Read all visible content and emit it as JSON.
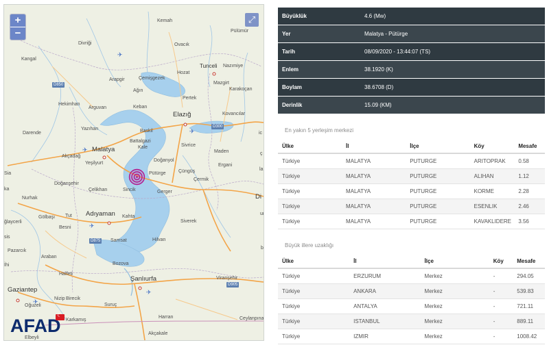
{
  "map": {
    "controls": {
      "zoom_in": "+",
      "zoom_out": "−",
      "fullscreen": "⤢"
    },
    "logo": "AFAD",
    "labels": {
      "kemah": "Kemah",
      "pulumur": "Pülümür",
      "divrigi": "Divriği",
      "ovacik": "Ovacık",
      "kangal": "Kangal",
      "tunceli": "Tunceli",
      "nazimiye": "Nazımiye",
      "arapgir": "Arapgir",
      "cemisgezek": "Çemişgezek",
      "hozat": "Hozat",
      "mazgirt": "Mazgirt",
      "karakocan": "Karakoçan",
      "agin": "Ağın",
      "pertek": "Pertek",
      "hekimhan": "Hekimhan",
      "arguvan": "Arguvan",
      "keban": "Keban",
      "elazig": "Elazığ",
      "kovancilar": "Kovancılar",
      "yazihan": "Yazıhan",
      "baskil": "Baskil",
      "darende": "Darende",
      "battalgazi": "Battalgazi",
      "sivrice": "Sivrice",
      "kale": "Kale",
      "malatya": "Malatya",
      "akcadag": "Akçadağ",
      "yesilyurt": "Yeşilyurt",
      "doganyol": "Doğanyol",
      "maden": "Maden",
      "puturge": "Pütürge",
      "cungus": "Çüngüş",
      "ergani": "Ergani",
      "doganshehir": "Doğanşehir",
      "celikhan": "Çelikhan",
      "sincik": "Sincik",
      "cermik": "Çermik",
      "gerger": "Gerger",
      "nurhak": "Nurhak",
      "golbasi": "Gölbaşı",
      "tut": "Tut",
      "adiyaman": "Adıyaman",
      "kahta": "Kahta",
      "siverek": "Siverek",
      "besni": "Besni",
      "samsat": "Samsat",
      "hilvan": "Hilvan",
      "pazarcik": "Pazarcık",
      "araban": "Araban",
      "bozova": "Bozova",
      "haifeti": "Halfeti",
      "sanliurfa": "Şanlıurfa",
      "viransehir": "Viranşehir",
      "gaziantep": "Gaziantep",
      "oguzeli": "Oğuzeli",
      "nizip": "Nizip",
      "birecik": "Birecik",
      "suruc": "Suruç",
      "harran": "Harran",
      "karkamis": "Karkamış",
      "akcakale": "Akçakale",
      "ceylanpinar": "Ceylanpınar",
      "elbeyli": "Elbeyli",
      "cag": "ğlaycerli",
      "sis": "sis",
      "di": "Di",
      "ic": "ic",
      "ur": "ur",
      "cb": "ç",
      "bi": "bi",
      "la": "la",
      "ka": "ka",
      "ihi": "İhi",
      "sia": "Sia"
    },
    "roads": {
      "d850": "D850",
      "d300": "D300",
      "d875": "D875",
      "d905": "D905"
    }
  },
  "info": [
    {
      "key": "Büyüklük",
      "value": "4.6 (Mw)"
    },
    {
      "key": "Yer",
      "value": "Malatya - Pütürge"
    },
    {
      "key": "Tarih",
      "value": "08/09/2020 - 13:44:07 (TS)"
    },
    {
      "key": "Enlem",
      "value": "38.1920 (K)"
    },
    {
      "key": "Boylam",
      "value": "38.6708 (D)"
    },
    {
      "key": "Derinlik",
      "value": "15.09 (KM)"
    }
  ],
  "nearest": {
    "title": "En yakın 5 yerleşim merkezi",
    "headers": [
      "Ülke",
      "İl",
      "İlçe",
      "Köy",
      "Mesafe"
    ],
    "rows": [
      [
        "Türkiye",
        "MALATYA",
        "PUTURGE",
        "ARITOPRAK",
        "0.58"
      ],
      [
        "Türkiye",
        "MALATYA",
        "PUTURGE",
        "ALIHAN",
        "1.12"
      ],
      [
        "Türkiye",
        "MALATYA",
        "PUTURGE",
        "KORME",
        "2.28"
      ],
      [
        "Türkiye",
        "MALATYA",
        "PUTURGE",
        "ESENLIK",
        "2.46"
      ],
      [
        "Türkiye",
        "MALATYA",
        "PUTURGE",
        "KAVAKLIDERE",
        "3.56"
      ]
    ]
  },
  "cities": {
    "title": "Büyük illere uzaklığı",
    "headers": [
      "Ülke",
      "İl",
      "İlçe",
      "Köy",
      "Mesafe"
    ],
    "rows": [
      [
        "Türkiye",
        "ERZURUM",
        "Merkez",
        "-",
        "294.05"
      ],
      [
        "Türkiye",
        "ANKARA",
        "Merkez",
        "-",
        "539.83"
      ],
      [
        "Türkiye",
        "ANTALYA",
        "Merkez",
        "-",
        "721.11"
      ],
      [
        "Türkiye",
        "ISTANBUL",
        "Merkez",
        "-",
        "889.11"
      ],
      [
        "Türkiye",
        "IZMIR",
        "Merkez",
        "-",
        "1008.42"
      ]
    ]
  }
}
